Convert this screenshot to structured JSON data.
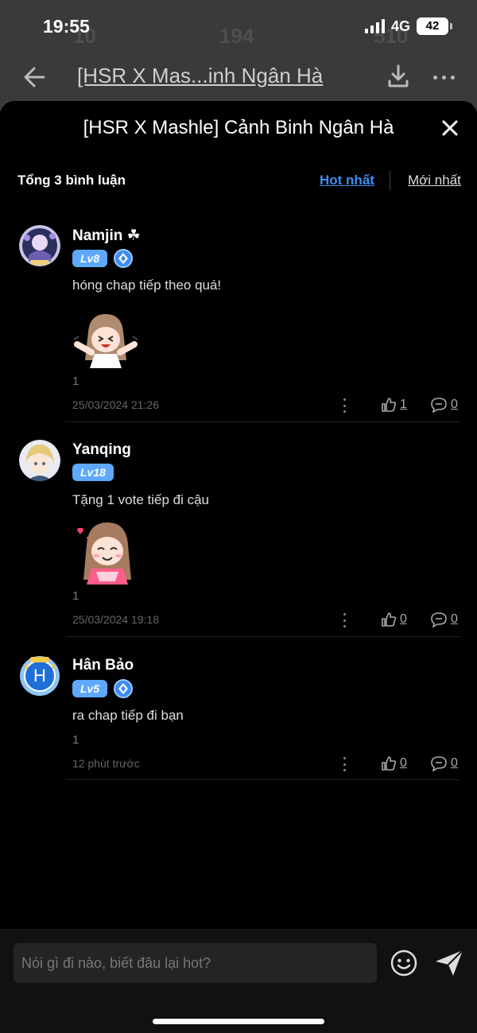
{
  "status": {
    "time": "19:55",
    "network": "4G",
    "battery": "42"
  },
  "background_page": {
    "title": "[HSR X Mas...inh Ngân Hà",
    "stats": [
      "10",
      "194",
      "510"
    ]
  },
  "sheet": {
    "title": "[HSR X Mashle] Cảnh Binh Ngân Hà",
    "total_comments": "Tổng 3 bình luận",
    "sort_hot": "Hot nhất",
    "sort_new": "Mới nhất"
  },
  "comments": [
    {
      "username": "Namjin ☘",
      "level": "Lv8",
      "text": "hóng chap tiếp theo quá!",
      "chapter": "1",
      "time": "25/03/2024 21:26",
      "likes": "1",
      "replies": "0"
    },
    {
      "username": "Yanqing",
      "level": "Lv18",
      "text": "Tặng 1 vote tiếp đi cậu",
      "chapter": "1",
      "time": "25/03/2024 19:18",
      "likes": "0",
      "replies": "0"
    },
    {
      "username": "Hân Bảo",
      "level": "Lv5",
      "avatar_letter": "H",
      "text": "ra chap tiếp đi bạn",
      "chapter": "1",
      "time": "12 phút trước",
      "likes": "0",
      "replies": "0"
    }
  ],
  "input": {
    "placeholder": "Nói gì đi nào, biết đâu lại hot?"
  },
  "colors": {
    "accent": "#3d8cf0",
    "level_badge": "#5ea8ff",
    "background": "#000000"
  },
  "icons": [
    "back-arrow-icon",
    "download-icon",
    "more-icon",
    "close-icon",
    "gem-icon",
    "kebab-icon",
    "thumbs-up-icon",
    "comment-icon",
    "emoji-icon",
    "send-icon"
  ]
}
